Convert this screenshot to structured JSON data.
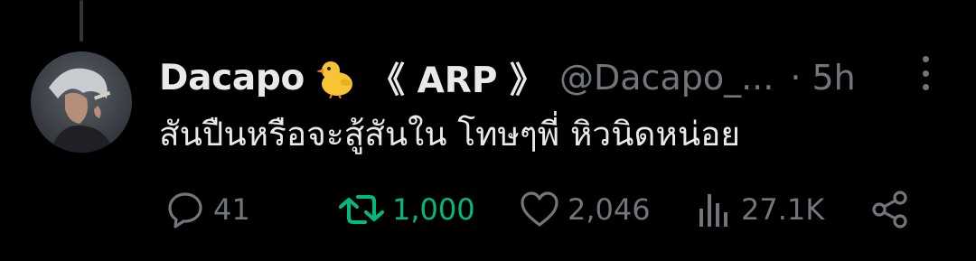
{
  "tweet": {
    "display_name": "Dacapo",
    "name_suffix": "《 ARP 》",
    "handle": "@Dacapo_...",
    "time": "· 5h",
    "text": "สันปืนหรือจะสู้สันใน โทษๆพี่ หิวนิดหน่อย",
    "name_emoji": "baby-chick-icon"
  },
  "actions": {
    "reply_count": "41",
    "retweet_count": "1,000",
    "like_count": "2,046",
    "views_count": "27.1K"
  },
  "colors": {
    "background": "#000000",
    "text_primary": "#e7e9ea",
    "text_secondary": "#71767b",
    "retweet_active": "#00ba7c"
  }
}
